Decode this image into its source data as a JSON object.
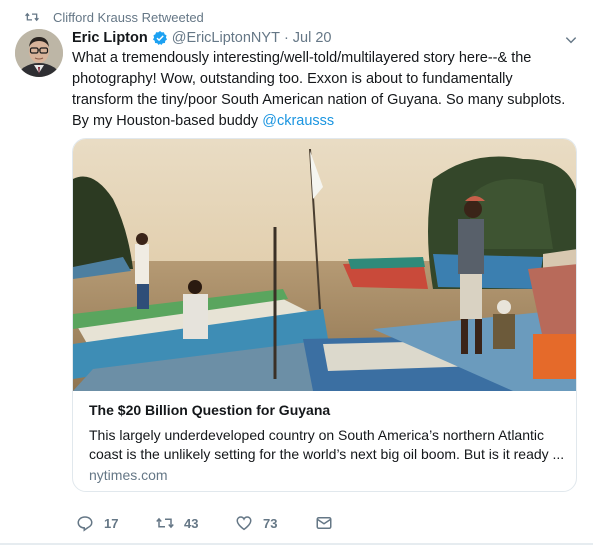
{
  "retweet": {
    "label": "Clifford Krauss Retweeted",
    "icon": "retweet-icon"
  },
  "author": {
    "name": "Eric Lipton",
    "handle": "@EricLiptonNYT",
    "separator": "·",
    "time": "Jul 20",
    "verified_icon": "verified-badge-icon"
  },
  "tweet": {
    "text_before_mention": "What a tremendously interesting/well-told/multilayered story here--& the photography! Wow, outstanding too. Exxon is about to fundamentally transform the tiny/poor South American nation of Guyana. So many subplots. By my Houston-based buddy ",
    "mention": "@ckrausss"
  },
  "card": {
    "title": "The $20 Billion Question for Guyana",
    "description": "This largely underdeveloped country on South America’s northern Atlantic coast is the unlikely setting for the world’s next big oil boom. But is it ready ...",
    "domain": "nytimes.com"
  },
  "actions": {
    "reply_count": "17",
    "retweet_count": "43",
    "like_count": "73"
  },
  "colors": {
    "link": "#1b95e0",
    "muted": "#657786",
    "verified": "#1da1f2",
    "border": "#e1e8ed"
  }
}
